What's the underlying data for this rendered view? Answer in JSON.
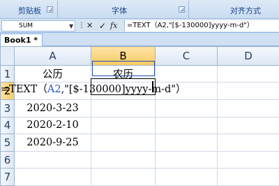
{
  "ribbon": {
    "groups": [
      {
        "label": "剪贴板"
      },
      {
        "label": "字体"
      },
      {
        "label": "对齐方式"
      }
    ]
  },
  "formula_bar": {
    "name_box": "SUM",
    "cancel_symbol": "✕",
    "enter_symbol": "✓",
    "fx_symbol": "fx",
    "formula": "=TEXT（A2,\"[$-130000]yyyy-m-d\"）"
  },
  "workbook_tab": {
    "label": "Book1 *"
  },
  "grid": {
    "columns": [
      "A",
      "B",
      "C",
      "D"
    ],
    "rows": [
      "1",
      "2",
      "3",
      "4",
      "5",
      "6",
      "7"
    ],
    "cells": {
      "A1": "公历",
      "B1": "农历",
      "A3": "2020-3-23",
      "A4": "2020-2-10",
      "A5": "2020-9-25"
    },
    "editing": {
      "prefix": "=TEXT（",
      "ref": "A2",
      "suffix": ",\"[$-130000]yyyy-m-d\"）"
    },
    "active_cell": "B2"
  },
  "colors": {
    "ribbon_text": "#15428b",
    "active_header": "#f8c962",
    "reference_blue": "#1f57c3"
  }
}
